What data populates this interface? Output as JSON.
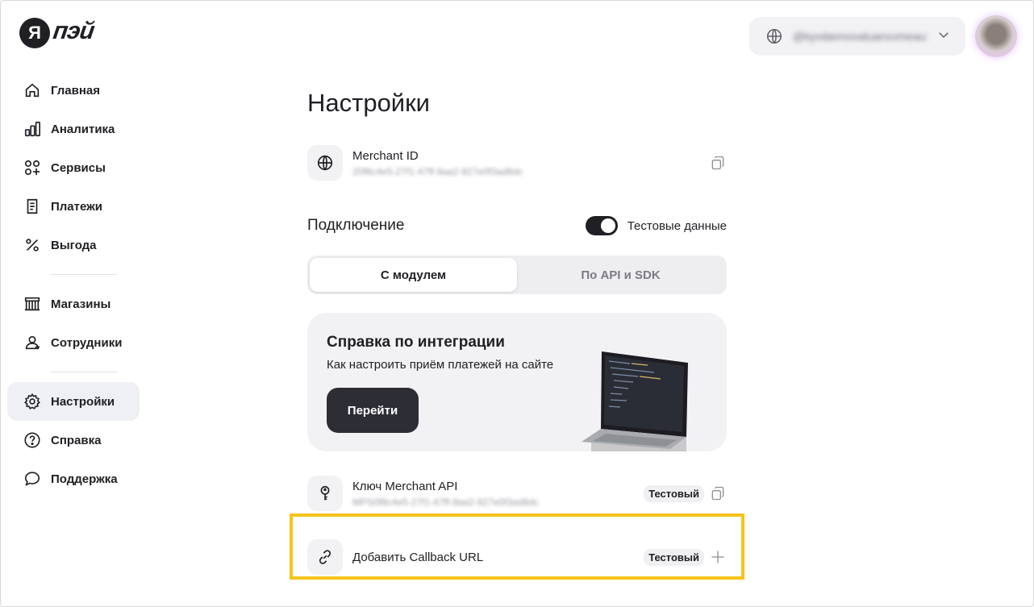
{
  "logo": {
    "mark": "Я",
    "word": "пэй"
  },
  "sidebar": {
    "items": [
      {
        "label": "Главная",
        "icon": "home-icon"
      },
      {
        "label": "Аналитика",
        "icon": "bar-chart-icon"
      },
      {
        "label": "Сервисы",
        "icon": "services-icon"
      },
      {
        "label": "Платежи",
        "icon": "receipt-icon"
      },
      {
        "label": "Выгода",
        "icon": "percent-icon"
      },
      {
        "label": "Магазины",
        "icon": "store-icon"
      },
      {
        "label": "Сотрудники",
        "icon": "employees-icon"
      },
      {
        "label": "Настройки",
        "icon": "gear-icon",
        "active": true
      },
      {
        "label": "Справка",
        "icon": "help-circle-icon"
      },
      {
        "label": "Поддержка",
        "icon": "chat-icon"
      }
    ]
  },
  "header": {
    "account_name": "@kyvdannovaluanxvmeaux"
  },
  "main": {
    "title": "Настройки",
    "merchant": {
      "title": "Merchant ID",
      "value": "20f8c4e5-27f1-47ff-9aa2-927e0f3ad8dc"
    },
    "connection": {
      "title": "Подключение",
      "toggle_label": "Тестовые данные",
      "toggle_on": true,
      "tabs": [
        {
          "label": "С модулем",
          "active": true
        },
        {
          "label": "По API и SDK",
          "active": false
        }
      ]
    },
    "help_card": {
      "title": "Справка по интеграции",
      "subtitle": "Как настроить приём платежей на сайте",
      "button": "Перейти"
    },
    "api_key": {
      "title": "Ключ Merchant API",
      "value": "MPS0f8c4e5-27f1-47ff-9aa2-927e0f3ad8dc",
      "badge": "Тестовый"
    },
    "callback": {
      "title": "Добавить Callback URL",
      "badge": "Тестовый"
    }
  },
  "colors": {
    "text": "#1f1f24",
    "surface": "#f2f2f5",
    "highlight": "#f5c518",
    "button_dark": "#2d2d36"
  }
}
